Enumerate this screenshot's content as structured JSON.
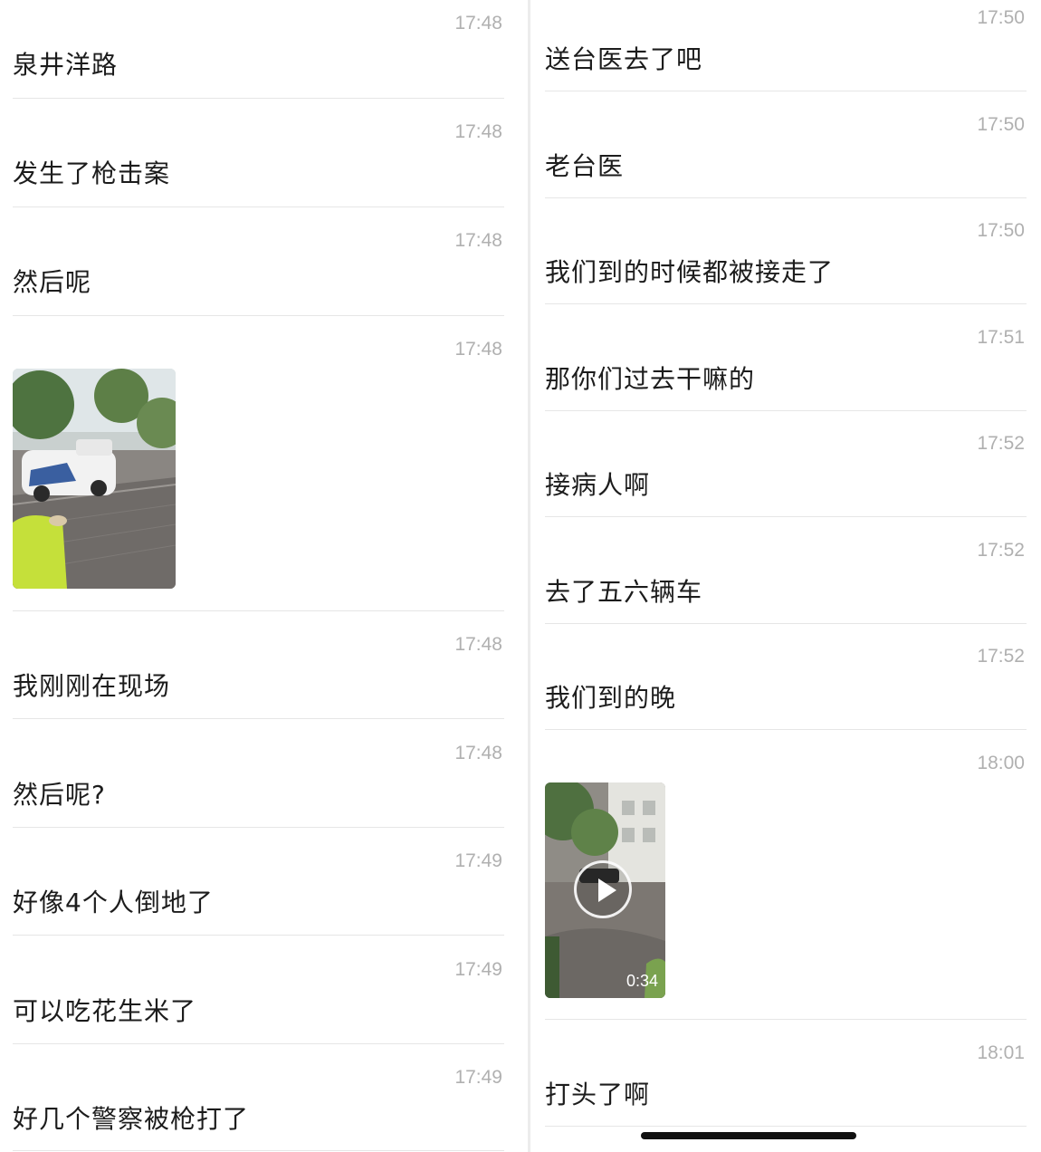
{
  "left_messages": [
    {
      "time": "17:48",
      "text": "泉井洋路"
    },
    {
      "time": "17:48",
      "text": "发生了枪击案"
    },
    {
      "time": "17:48",
      "text": "然后呢"
    },
    {
      "time": "17:48",
      "image": "police-car-photo"
    },
    {
      "time": "17:48",
      "text": "我刚刚在现场"
    },
    {
      "time": "17:48",
      "text": "然后呢?"
    },
    {
      "time": "17:49",
      "text": "好像4个人倒地了"
    },
    {
      "time": "17:49",
      "text": "可以吃花生米了"
    },
    {
      "time": "17:49",
      "text": "好几个警察被枪打了"
    }
  ],
  "right_messages": [
    {
      "time": "17:50",
      "text": "送台医去了吧"
    },
    {
      "time": "17:50",
      "text": "老台医"
    },
    {
      "time": "17:50",
      "text": "我们到的时候都被接走了"
    },
    {
      "time": "17:51",
      "text": "那你们过去干嘛的"
    },
    {
      "time": "17:52",
      "text": "接病人啊"
    },
    {
      "time": "17:52",
      "text": "去了五六辆车"
    },
    {
      "time": "17:52",
      "text": "我们到的晚"
    },
    {
      "time": "18:00",
      "video_duration": "0:34"
    },
    {
      "time": "18:01",
      "text": "打头了啊"
    }
  ],
  "colors": {
    "time": "#b0b0b0",
    "separator": "#e6e6e6",
    "text": "#1c1c1c"
  }
}
